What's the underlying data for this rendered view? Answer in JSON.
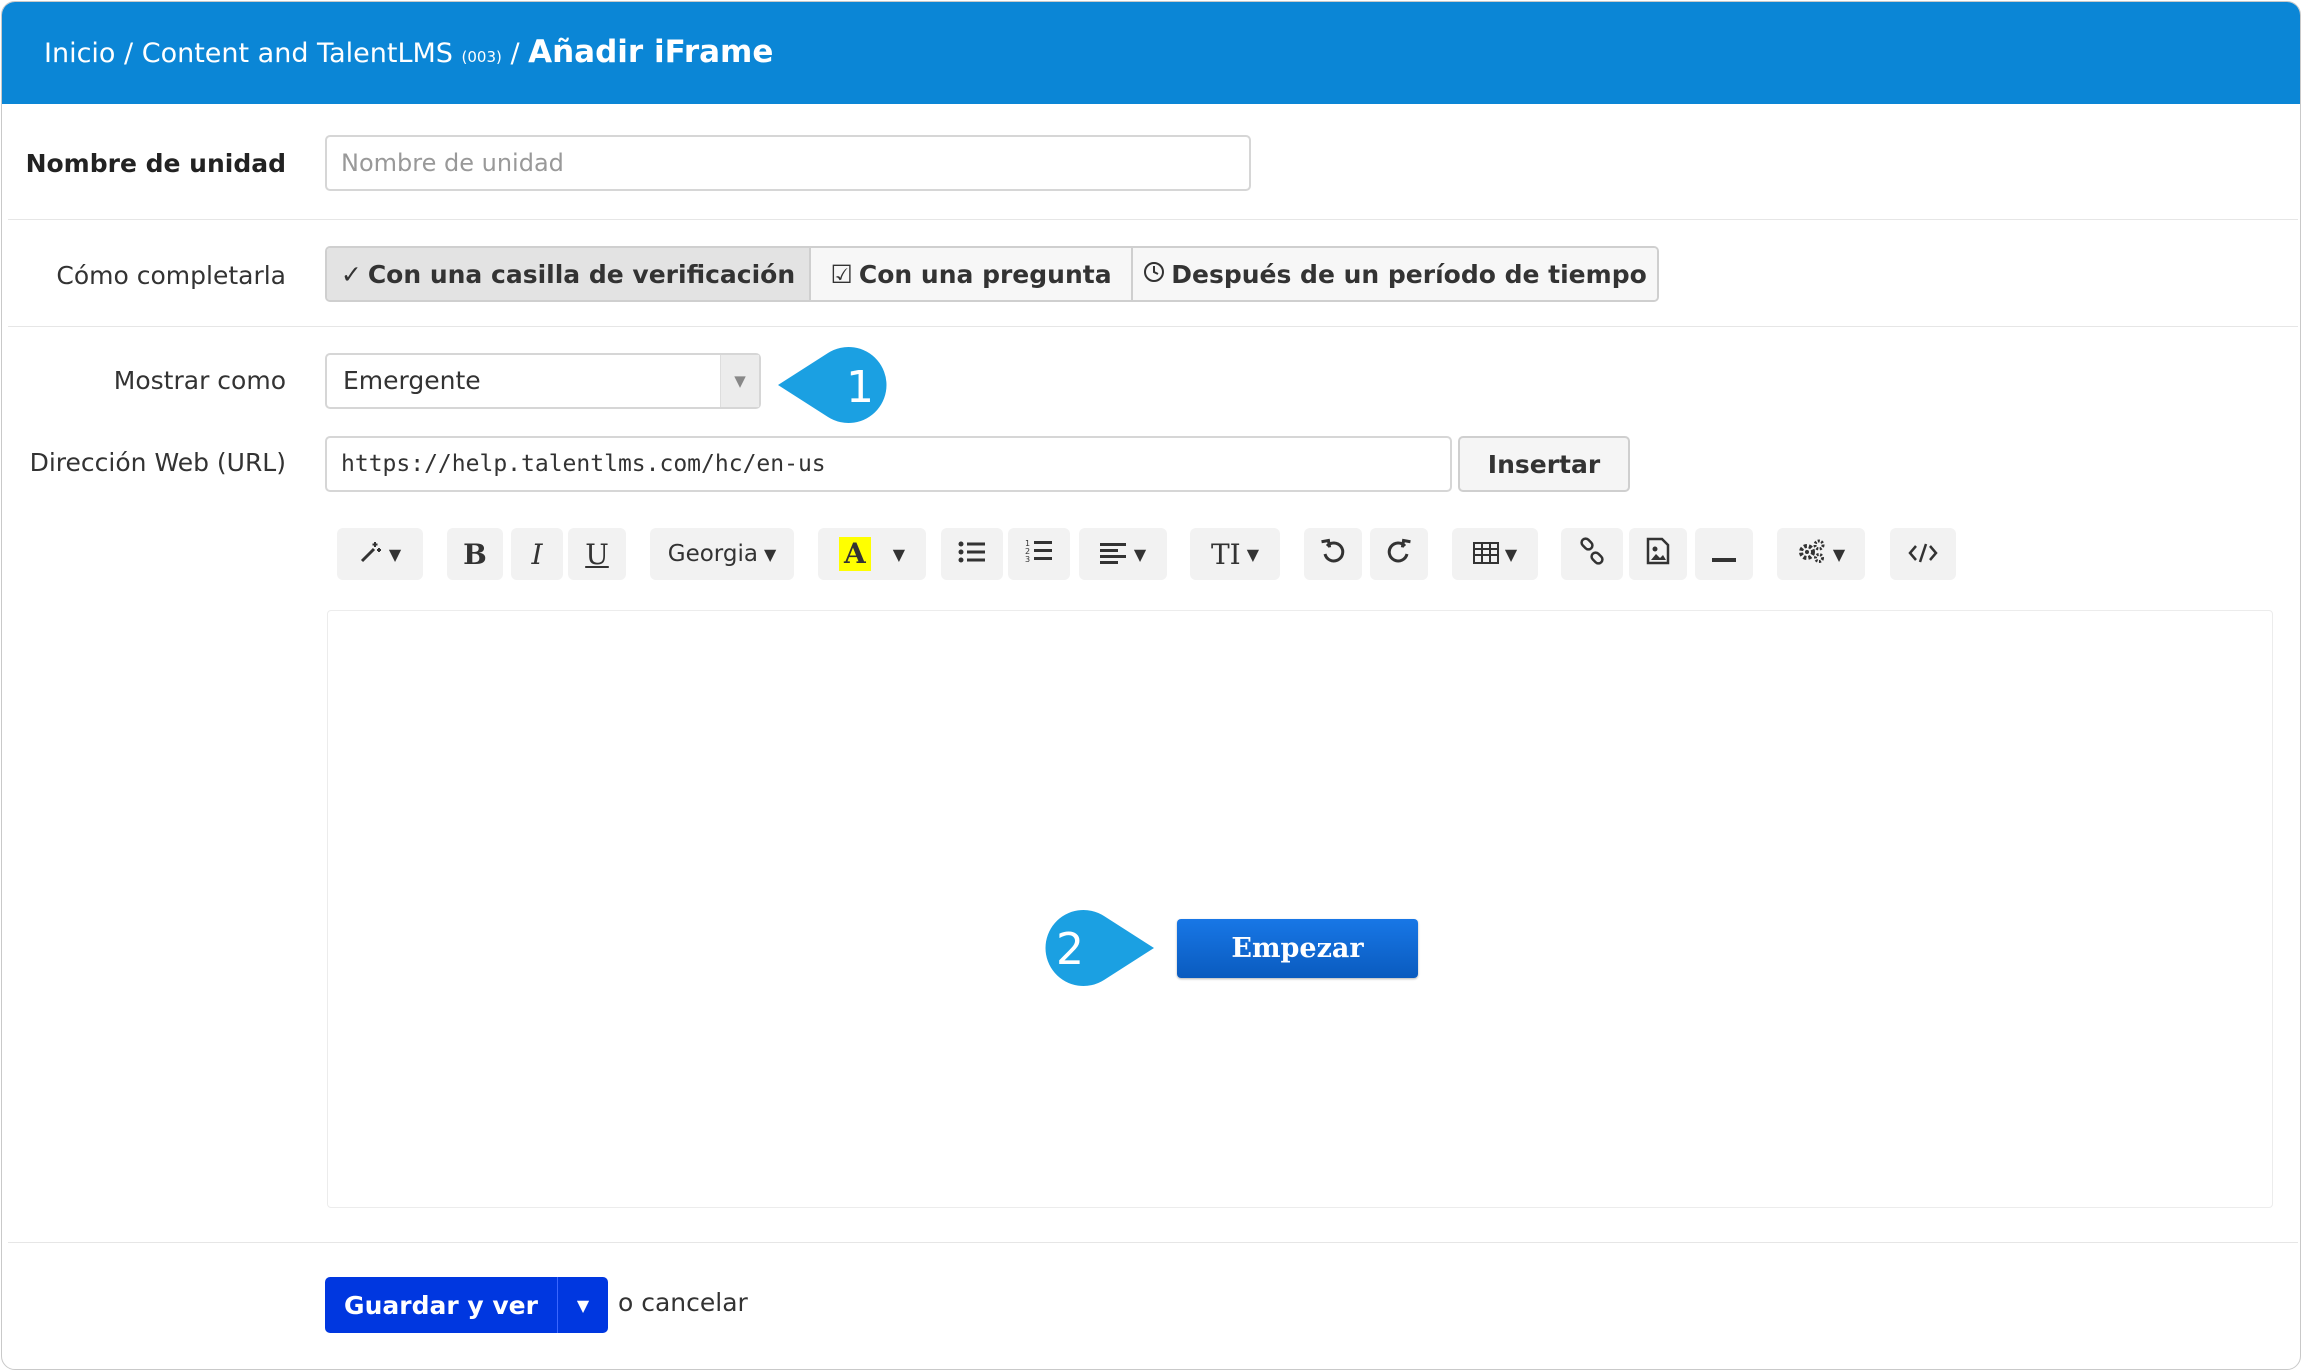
{
  "header": {
    "crumb_home": "Inicio",
    "crumb_sep1": " / ",
    "crumb_course": "Content and TalentLMS",
    "crumb_course_code": "(003)",
    "crumb_sep2": " / ",
    "crumb_current": "Añadir iFrame"
  },
  "form": {
    "unit_name_label": "Nombre de unidad",
    "unit_name_placeholder": "Nombre de unidad",
    "completion_label": "Cómo completarla",
    "completion_options": [
      {
        "label": "Con una casilla de verificación",
        "icon": "check-icon"
      },
      {
        "label": "Con una pregunta",
        "icon": "checkbox-icon"
      },
      {
        "label": "Después de un período de tiempo",
        "icon": "clock-icon"
      }
    ],
    "display_label": "Mostrar como",
    "display_value": "Emergente",
    "url_label": "Dirección Web (URL)",
    "url_value": "https://help.talentlms.com/hc/en-us",
    "insert_label": "Insertar"
  },
  "toolbar": {
    "font_name": "Georgia",
    "bold": "B",
    "italic": "I",
    "underline": "U",
    "color": "A",
    "text_size": "TI",
    "highlight_color": "#ffff00"
  },
  "editor": {
    "start_button": "Empezar"
  },
  "footer": {
    "save_label": "Guardar y ver",
    "cancel_text": "o cancelar"
  },
  "callouts": {
    "one": "1",
    "two": "2",
    "color": "#1ba0e2"
  },
  "colors": {
    "header": "#0b86d6",
    "primary": "#0037e0"
  }
}
